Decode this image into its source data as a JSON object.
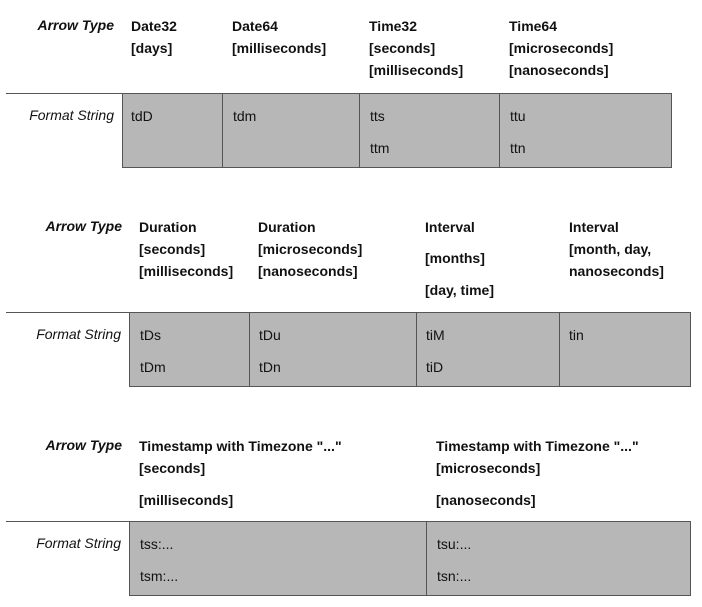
{
  "row_label_arrow": "Arrow Type",
  "row_label_format": "Format String",
  "tables": [
    {
      "columns": [
        {
          "header": [
            "Date32",
            "[days]"
          ],
          "formats": [
            "tdD"
          ]
        },
        {
          "header": [
            "Date64",
            "[milliseconds]"
          ],
          "formats": [
            "tdm"
          ]
        },
        {
          "header": [
            "Time32",
            "[seconds]",
            "[milliseconds]"
          ],
          "formats": [
            "tts",
            "ttm"
          ]
        },
        {
          "header": [
            "Time64",
            "[microseconds]",
            "[nanoseconds]"
          ],
          "formats": [
            "ttu",
            "ttn"
          ]
        }
      ]
    },
    {
      "columns": [
        {
          "header": [
            "Duration",
            "[seconds]",
            "[milliseconds]"
          ],
          "formats": [
            "tDs",
            "tDm"
          ]
        },
        {
          "header": [
            "Duration",
            "[microseconds]",
            "[nanoseconds]"
          ],
          "formats": [
            "tDu",
            "tDn"
          ]
        },
        {
          "header": [
            "Interval",
            "[months]",
            "[day, time]"
          ],
          "formats": [
            "tiM",
            "tiD"
          ]
        },
        {
          "header": [
            "Interval",
            "[month, day,",
            "nanoseconds]"
          ],
          "formats": [
            "tin"
          ]
        }
      ]
    },
    {
      "columns": [
        {
          "header": [
            "Timestamp with Timezone \"...\"",
            "[seconds]",
            "[milliseconds]"
          ],
          "formats": [
            "tss:...",
            "tsm:..."
          ]
        },
        {
          "header": [
            "Timestamp with Timezone \"...\"",
            "[microseconds]",
            "[nanoseconds]"
          ],
          "formats": [
            "tsu:...",
            "tsn:..."
          ]
        }
      ]
    }
  ]
}
